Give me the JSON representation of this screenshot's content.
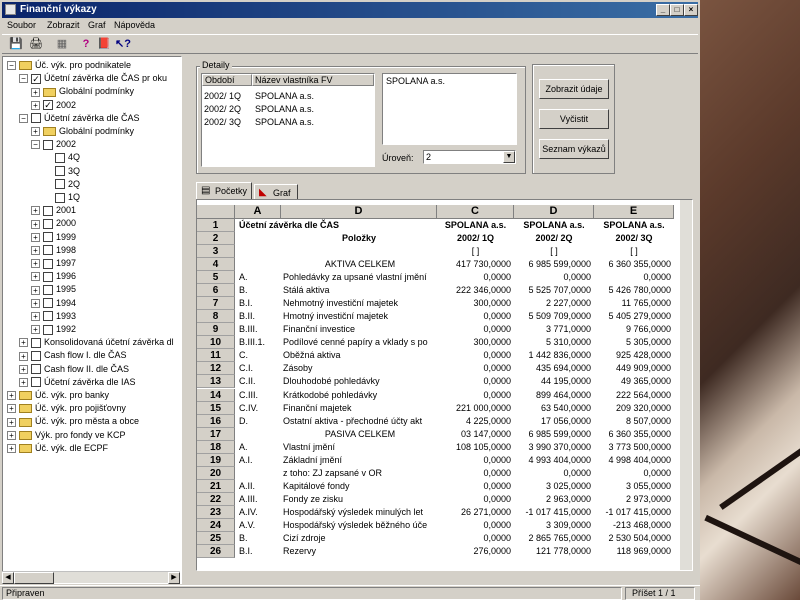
{
  "window": {
    "title": "Finanční výkazy"
  },
  "menu": [
    "Soubor",
    "Zobrazit",
    "Graf",
    "Nápověda"
  ],
  "tree": [
    {
      "label": "Úč. výk. pro podnikatele",
      "level": 0,
      "expander": "−",
      "folder": true
    },
    {
      "label": "Účetní závěrka dle ČAS pr oku",
      "level": 1,
      "expander": "−",
      "check": "✓"
    },
    {
      "label": "Globální podmínky",
      "level": 2,
      "expander": "+",
      "folder": true
    },
    {
      "label": "2002",
      "level": 2,
      "expander": "+",
      "check": "✓"
    },
    {
      "label": "Účetní závěrka dle ČAS",
      "level": 1,
      "expander": "−",
      "check": ""
    },
    {
      "label": "Globální podmínky",
      "level": 2,
      "expander": "+",
      "folder": true
    },
    {
      "label": "2002",
      "level": 2,
      "expander": "−",
      "check": ""
    },
    {
      "label": "4Q",
      "level": 3,
      "check": ""
    },
    {
      "label": "3Q",
      "level": 3,
      "check": ""
    },
    {
      "label": "2Q",
      "level": 3,
      "check": ""
    },
    {
      "label": "1Q",
      "level": 3,
      "check": ""
    },
    {
      "label": "2001",
      "level": 2,
      "expander": "+",
      "check": ""
    },
    {
      "label": "2000",
      "level": 2,
      "expander": "+",
      "check": ""
    },
    {
      "label": "1999",
      "level": 2,
      "expander": "+",
      "check": ""
    },
    {
      "label": "1998",
      "level": 2,
      "expander": "+",
      "check": ""
    },
    {
      "label": "1997",
      "level": 2,
      "expander": "+",
      "check": ""
    },
    {
      "label": "1996",
      "level": 2,
      "expander": "+",
      "check": ""
    },
    {
      "label": "1995",
      "level": 2,
      "expander": "+",
      "check": ""
    },
    {
      "label": "1994",
      "level": 2,
      "expander": "+",
      "check": ""
    },
    {
      "label": "1993",
      "level": 2,
      "expander": "+",
      "check": ""
    },
    {
      "label": "1992",
      "level": 2,
      "expander": "+",
      "check": ""
    },
    {
      "label": "Konsolidovaná účetní závěrka dl",
      "level": 1,
      "expander": "+",
      "check": ""
    },
    {
      "label": "Cash flow I. dle ČAS",
      "level": 1,
      "expander": "+",
      "check": ""
    },
    {
      "label": "Cash flow II. dle ČAS",
      "level": 1,
      "expander": "+",
      "check": ""
    },
    {
      "label": "Účetní závěrka dle IAS",
      "level": 1,
      "expander": "+",
      "check": ""
    },
    {
      "label": "Úč. výk. pro banky",
      "level": 0,
      "expander": "+",
      "folder": true
    },
    {
      "label": "Úč. výk. pro pojišťovny",
      "level": 0,
      "expander": "+",
      "folder": true
    },
    {
      "label": "Úč. výk. pro města a obce",
      "level": 0,
      "expander": "+",
      "folder": true
    },
    {
      "label": "Výk. pro fondy ve KCP",
      "level": 0,
      "expander": "+",
      "folder": true
    },
    {
      "label": "Úč. výk. dle ECPF",
      "level": 0,
      "expander": "+",
      "folder": true
    }
  ],
  "detail": {
    "group_label": "Detaily",
    "columns": [
      "Období",
      "Název vlastníka FV"
    ],
    "rows": [
      [
        "2002/ 1Q",
        "SPOLANA a.s."
      ],
      [
        "2002/ 2Q",
        "SPOLANA a.s."
      ],
      [
        "2002/ 3Q",
        "SPOLANA a.s."
      ]
    ],
    "textbox": "SPOLANA a.s.",
    "level_label": "Úroveň:",
    "level_value": "2"
  },
  "buttons": {
    "show": "Zobrazit údaje",
    "clear": "Vyčistit",
    "list": "Seznam výkazů"
  },
  "tabs": {
    "table": "Početky",
    "graph": "Graf"
  },
  "grid": {
    "col_headers": [
      "A",
      "D",
      "C",
      "D",
      "E"
    ],
    "title": "Účetní závěrka dle ČAS",
    "items_label": "Položky",
    "company": "SPOLANA a.s.",
    "periods": [
      "2002/ 1Q",
      "2002/ 2Q",
      "2002/ 3Q"
    ],
    "unit": "[ ]",
    "rows": [
      {
        "n": "4",
        "a": "",
        "d": "AKTIVA CELKEM",
        "c": "417 730,0000",
        "dd": "6 985 599,0000",
        "e": "6 360 355,0000",
        "center": true
      },
      {
        "n": "5",
        "a": "A.",
        "d": "Pohledávky za upsané vlastní jmění",
        "c": "0,0000",
        "dd": "0,0000",
        "e": "0,0000"
      },
      {
        "n": "6",
        "a": "B.",
        "d": "Stálá aktiva",
        "c": "222 346,0000",
        "dd": "5 525 707,0000",
        "e": "5 426 780,0000"
      },
      {
        "n": "7",
        "a": "B.I.",
        "d": "Nehmotný investiční majetek",
        "c": "300,0000",
        "dd": "2 227,0000",
        "e": "11 765,0000"
      },
      {
        "n": "8",
        "a": "B.II.",
        "d": "Hmotný investiční majetek",
        "c": "0,0000",
        "dd": "5 509 709,0000",
        "e": "5 405 279,0000"
      },
      {
        "n": "9",
        "a": "B.III.",
        "d": "Finanční investice",
        "c": "0,0000",
        "dd": "3 771,0000",
        "e": "9 766,0000"
      },
      {
        "n": "10",
        "a": "B.III.1.",
        "d": "Podílové cenné papíry a vklady s po",
        "c": "300,0000",
        "dd": "5 310,0000",
        "e": "5 305,0000"
      },
      {
        "n": "11",
        "a": "C.",
        "d": "Oběžná aktiva",
        "c": "0,0000",
        "dd": "1 442 836,0000",
        "e": "925 428,0000"
      },
      {
        "n": "12",
        "a": "C.I.",
        "d": "Zásoby",
        "c": "0,0000",
        "dd": "435 694,0000",
        "e": "449 909,0000"
      },
      {
        "n": "13",
        "a": "C.II.",
        "d": "Dlouhodobé pohledávky",
        "c": "0,0000",
        "dd": "44 195,0000",
        "e": "49 365,0000"
      },
      {
        "n": "14",
        "a": "C.III.",
        "d": "Krátkodobé pohledávky",
        "c": "0,0000",
        "dd": "899 464,0000",
        "e": "222 564,0000"
      },
      {
        "n": "15",
        "a": "C.IV.",
        "d": "Finanční majetek",
        "c": "221 000,0000",
        "dd": "63 540,0000",
        "e": "209 320,0000"
      },
      {
        "n": "16",
        "a": "D.",
        "d": "Ostatní aktiva - přechodné účty akt",
        "c": "4 225,0000",
        "dd": "17 056,0000",
        "e": "8 507,0000"
      },
      {
        "n": "17",
        "a": "",
        "d": "PASIVA CELKEM",
        "c": "03 147,0000",
        "dd": "6 985 599,0000",
        "e": "6 360 355,0000",
        "center": true
      },
      {
        "n": "18",
        "a": "A.",
        "d": "Vlastní jmění",
        "c": "108 105,0000",
        "dd": "3 990 370,0000",
        "e": "3 773 500,0000"
      },
      {
        "n": "19",
        "a": "A.I.",
        "d": "Základní jmění",
        "c": "0,0000",
        "dd": "4 993 404,0000",
        "e": "4 998 404,0000"
      },
      {
        "n": "20",
        "a": "",
        "d": "z toho: ZJ zapsané v OR",
        "c": "0,0000",
        "dd": "0,0000",
        "e": "0,0000"
      },
      {
        "n": "21",
        "a": "A.II.",
        "d": "Kapitálové fondy",
        "c": "0,0000",
        "dd": "3 025,0000",
        "e": "3 055,0000"
      },
      {
        "n": "22",
        "a": "A.III.",
        "d": "Fondy ze zisku",
        "c": "0,0000",
        "dd": "2 963,0000",
        "e": "2 973,0000"
      },
      {
        "n": "23",
        "a": "A.IV.",
        "d": "Hospodářský výsledek minulých let",
        "c": "26 271,0000",
        "dd": "-1 017 415,0000",
        "e": "-1 017 415,0000"
      },
      {
        "n": "24",
        "a": "A.V.",
        "d": "Hospodářský výsledek běžného úče",
        "c": "0,0000",
        "dd": "3 309,0000",
        "e": "-213 468,0000"
      },
      {
        "n": "25",
        "a": "B.",
        "d": "Cizí zdroje",
        "c": "0,0000",
        "dd": "2 865 765,0000",
        "e": "2 530 504,0000"
      },
      {
        "n": "26",
        "a": "B.I.",
        "d": "Rezervy",
        "c": "276,0000",
        "dd": "121 778,0000",
        "e": "118 969,0000"
      }
    ]
  },
  "status": {
    "left": "Připraven",
    "right": "Příšet 1 / 1"
  }
}
